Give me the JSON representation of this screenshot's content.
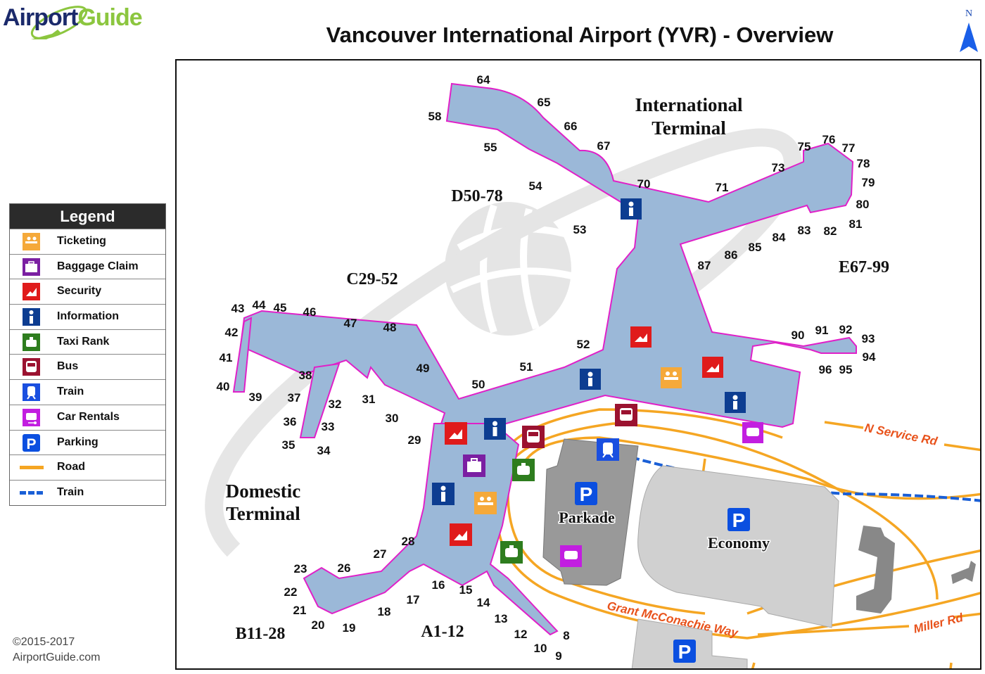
{
  "header": {
    "logo_part1": "Airport",
    "logo_part2": "Guide",
    "title": "Vancouver International Airport (YVR) - Overview",
    "north_label": "N"
  },
  "legend": {
    "title": "Legend",
    "items": [
      {
        "label": "Ticketing",
        "icon": "ticketing-icon",
        "color": "#f5a93a"
      },
      {
        "label": "Baggage Claim",
        "icon": "baggage-claim-icon",
        "color": "#7b1fa2"
      },
      {
        "label": "Security",
        "icon": "security-icon",
        "color": "#e01b1b"
      },
      {
        "label": "Information",
        "icon": "information-icon",
        "color": "#0d3d91"
      },
      {
        "label": "Taxi Rank",
        "icon": "taxi-icon",
        "color": "#2e7d1e"
      },
      {
        "label": "Bus",
        "icon": "bus-icon",
        "color": "#9b1230"
      },
      {
        "label": "Train",
        "icon": "train-icon",
        "color": "#1a4fe0"
      },
      {
        "label": "Car Rentals",
        "icon": "car-rental-icon",
        "color": "#c21ee0"
      },
      {
        "label": "Parking",
        "icon": "parking-icon",
        "color": "#0b4fe0"
      },
      {
        "label": "Road",
        "icon": "road-line-icon",
        "color": "#f5a623"
      },
      {
        "label": "Train",
        "icon": "train-line-icon",
        "color": "#1a5fd6"
      }
    ]
  },
  "copyright": {
    "line1": "©2015-2017",
    "line2": "AirportGuide.com"
  },
  "map": {
    "terminals": {
      "international": [
        "International",
        "Terminal"
      ],
      "domestic": [
        "Domestic",
        "Terminal"
      ]
    },
    "concourses": [
      "D50-78",
      "C29-52",
      "E67-99",
      "B11-28",
      "A1-12"
    ],
    "parking_labels": [
      "Parkade",
      "Economy"
    ],
    "roads": [
      "N Service Rd",
      "Grant McConachie Way",
      "Miller Rd"
    ],
    "gates": [
      "64",
      "65",
      "58",
      "66",
      "55",
      "67",
      "54",
      "70",
      "71",
      "73",
      "75",
      "76",
      "77",
      "78",
      "79",
      "80",
      "81",
      "82",
      "83",
      "84",
      "85",
      "86",
      "87",
      "53",
      "52",
      "51",
      "50",
      "49",
      "48",
      "47",
      "46",
      "45",
      "44",
      "43",
      "42",
      "41",
      "40",
      "39",
      "38",
      "37",
      "36",
      "35",
      "34",
      "33",
      "32",
      "31",
      "30",
      "29",
      "90",
      "91",
      "92",
      "93",
      "94",
      "96",
      "95",
      "28",
      "27",
      "26",
      "23",
      "22",
      "21",
      "20",
      "19",
      "18",
      "17",
      "16",
      "15",
      "14",
      "13",
      "12",
      "10",
      "9",
      "8"
    ]
  }
}
